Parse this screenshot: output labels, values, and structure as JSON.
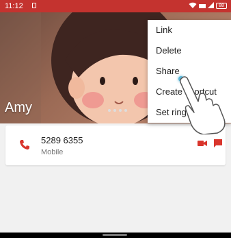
{
  "status_bar": {
    "time": "11:12",
    "battery": "88"
  },
  "contact": {
    "name": "Amy"
  },
  "phone": {
    "number": "5289 6355",
    "type": "Mobile"
  },
  "menu": {
    "items": [
      {
        "label": "Link"
      },
      {
        "label": "Delete"
      },
      {
        "label": "Share"
      },
      {
        "label": "Create shortcut"
      },
      {
        "label": "Set ring"
      }
    ]
  },
  "colors": {
    "accent": "#c4332f",
    "status_bar": "#c4332f",
    "touch": "#5ab6d8"
  },
  "icons": {
    "phone": "phone-icon",
    "video": "video-icon",
    "message": "message-icon",
    "wifi": "wifi-icon",
    "battery": "battery-icon"
  }
}
